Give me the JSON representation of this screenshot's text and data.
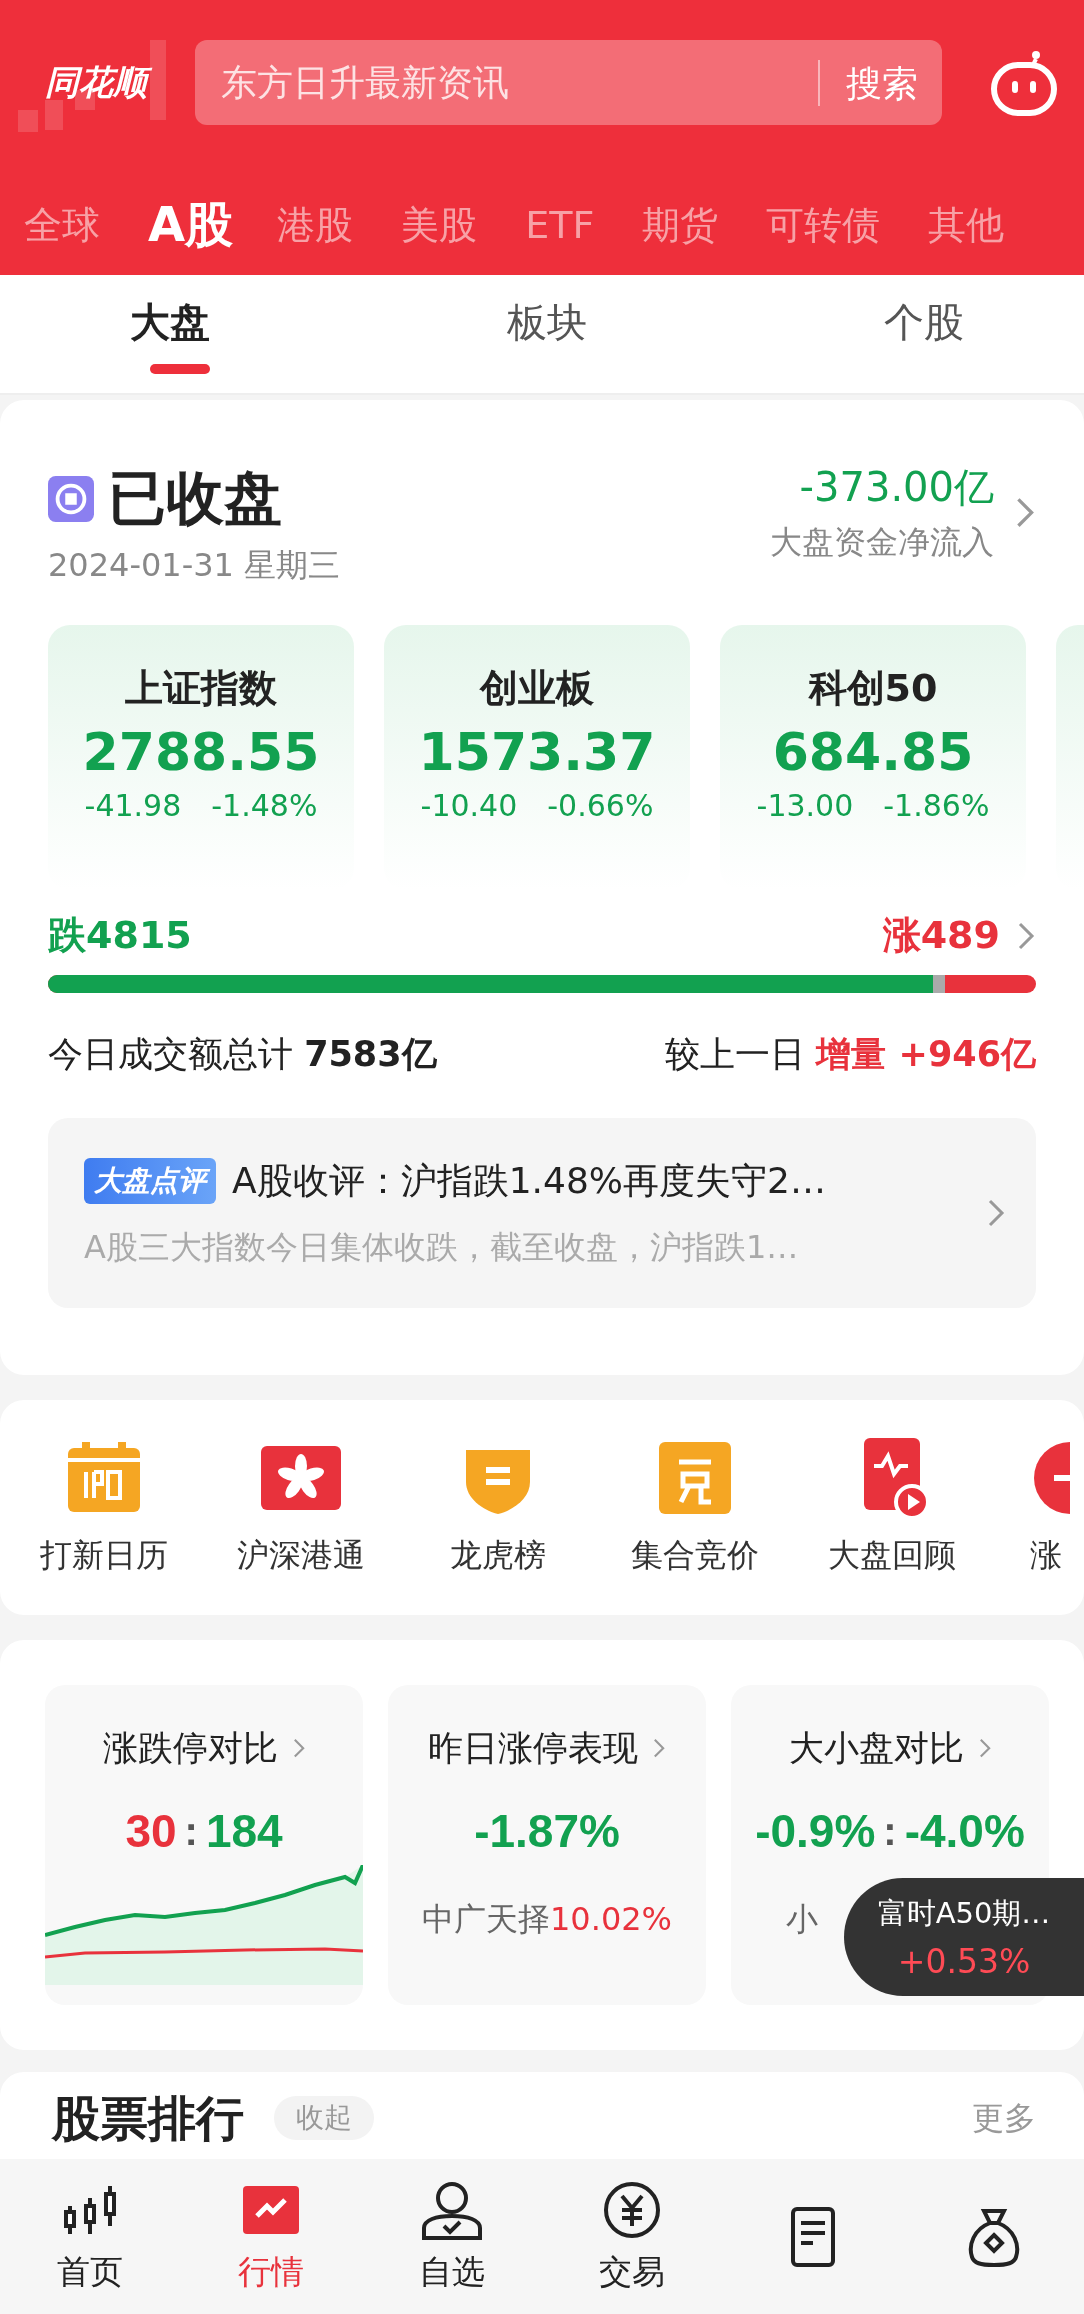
{
  "header": {
    "logo": "同花顺",
    "search": {
      "placeholder": "东方日升最新资讯",
      "button": "搜索"
    }
  },
  "market_tabs": [
    {
      "label": "全球",
      "selected": false
    },
    {
      "label": "A股",
      "selected": true
    },
    {
      "label": "港股",
      "selected": false
    },
    {
      "label": "美股",
      "selected": false
    },
    {
      "label": "ETF",
      "selected": false
    },
    {
      "label": "期货",
      "selected": false
    },
    {
      "label": "可转债",
      "selected": false
    },
    {
      "label": "其他",
      "selected": false
    }
  ],
  "sub_tabs": [
    {
      "label": "大盘",
      "selected": true
    },
    {
      "label": "板块",
      "selected": false
    },
    {
      "label": "个股",
      "selected": false
    }
  ],
  "status": {
    "title": "已收盘",
    "date": "2024-01-31 星期三",
    "net_flow": "-373.00亿",
    "net_flow_label": "大盘资金净流入"
  },
  "indices": [
    {
      "name": "上证指数",
      "value": "2788.55",
      "change": "-41.98",
      "percent": "-1.48%"
    },
    {
      "name": "创业板",
      "value": "1573.37",
      "change": "-10.40",
      "percent": "-0.66%"
    },
    {
      "name": "科创50",
      "value": "684.85",
      "change": "-13.00",
      "percent": "-1.86%"
    }
  ],
  "breadth": {
    "fall": "跌4815",
    "rise": "涨489",
    "level": 0.908
  },
  "volume": {
    "label": "今日成交额总计",
    "value": "7583亿",
    "compare_label": "较上一日",
    "change_label": "增量",
    "change": "+946亿"
  },
  "news": {
    "badge": "大盘点评",
    "title": "A股收评：沪指跌1.48%再度失守2…",
    "summary": "A股三大指数今日集体收跌，截至收盘，沪指跌1…"
  },
  "shortcuts": [
    {
      "kind": "ipo",
      "label": "打新日历"
    },
    {
      "kind": "hk",
      "label": "沪深港通"
    },
    {
      "kind": "shield",
      "label": "龙虎榜"
    },
    {
      "kind": "auction",
      "label": "集合竞价"
    },
    {
      "kind": "replay",
      "label": "大盘回顾"
    },
    {
      "kind": "limit",
      "label": "涨"
    }
  ],
  "stat_cards": [
    {
      "kind": "ratio",
      "title": "涨跌停对比",
      "left": {
        "text": "30",
        "color": "#e8323c"
      },
      "separator": ":",
      "right": {
        "text": "184",
        "color": "#12a150"
      }
    },
    {
      "kind": "single",
      "title": "昨日涨停表现",
      "value": "-1.87%",
      "note": "中广天择",
      "note_value": "10.02%"
    },
    {
      "kind": "ratio",
      "title": "大小盘对比",
      "left": {
        "text": "-0.9%",
        "color": "#12a150"
      },
      "separator": ":",
      "right": {
        "text": "-4.0%",
        "color": "#12a150"
      },
      "note": "小"
    }
  ],
  "floating_quote": {
    "name": "富时A50期…",
    "change": "+0.53%"
  },
  "ranking": {
    "title": "股票排行",
    "toggle": "收起",
    "more": "更多"
  },
  "bottom_nav": [
    {
      "kind": "home",
      "label": "首页",
      "selected": false
    },
    {
      "kind": "market",
      "label": "行情",
      "selected": true
    },
    {
      "kind": "watch",
      "label": "自选",
      "selected": false
    },
    {
      "kind": "trade",
      "label": "交易",
      "selected": false
    },
    {
      "kind": "doc",
      "selected": false
    },
    {
      "kind": "bag",
      "selected": false
    }
  ]
}
